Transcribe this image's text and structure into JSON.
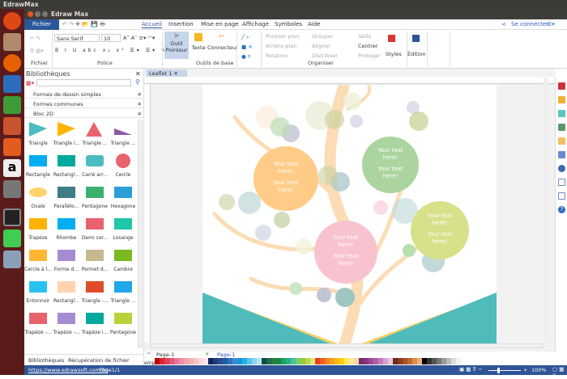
{
  "os": {
    "title": "EdrawMax"
  },
  "window": {
    "title": "Edraw Max"
  },
  "menu": {
    "file": "Fichier",
    "tabs": [
      "Accueil",
      "Insertion",
      "Mise en page",
      "Affichage",
      "Symboles",
      "Aide"
    ],
    "connect": "Se connecter"
  },
  "ribbon": {
    "font": "Sans Serif",
    "size": "10",
    "groups": [
      "Fichier",
      "Police",
      "Outils de base",
      "Organiser",
      "Styles",
      "Édition"
    ],
    "tools": {
      "pointer": "Outil Pointeur",
      "text": "Texte",
      "connector": "Connecteur"
    },
    "arrange": [
      "Premier plan",
      "Arrière-plan",
      "Rotation",
      "Grouper",
      "Aligner",
      "Distribuer",
      "Taille",
      "Centrer",
      "Protéger"
    ]
  },
  "library": {
    "title": "Bibliothèques",
    "sections": [
      "Formes de dessin simples",
      "Formes communes",
      "Bloc 2D"
    ],
    "shapes": [
      "Triangle",
      "Triangle i...",
      "Triangle ...",
      "Triangle ...",
      "Rectangle",
      "Rectangl...",
      "Carré arr...",
      "Cercle",
      "Ovale",
      "Parallélo...",
      "Pentagone",
      "Hexagone",
      "Trapèze",
      "Rhombe",
      "Demi cer...",
      "Losange",
      "Cercle à l...",
      "Forme d...",
      "Permet d...",
      "Cambre",
      "Entonnoir",
      "Rectangl...",
      "Triangle -...",
      "Triangle ...",
      "Trapèze -...",
      "Trapèze -...",
      "Trapèze i...",
      "Pentagone"
    ],
    "bottom_tabs": [
      "Bibliothèques",
      "Récupération de fichier"
    ]
  },
  "document": {
    "tab": "Leaflet 1",
    "bubble_text": "Your text here!",
    "page_select": "Page-1",
    "page_tab": "Page-1",
    "palette_label": "emp"
  },
  "status": {
    "url": "https://www.edrawsoft.com/fr/",
    "page": "Page1/1",
    "zoom": "100%"
  },
  "palette": [
    "#c00000",
    "#d9262f",
    "#e0405a",
    "#e2587a",
    "#e8739a",
    "#e891a8",
    "#f0a3a8",
    "#f3b2b0",
    "#f6c7c0",
    "#f9d8d8",
    "#fbe5ec",
    "#10255e",
    "#1f3a77",
    "#2e4a8e",
    "#1d5ea8",
    "#2d73c0",
    "#3c89d4",
    "#1499d8",
    "#21b0e4",
    "#55c3ec",
    "#8bd3f0",
    "#b3e0f2",
    "#0e4e3c",
    "#1a6b4f",
    "#2a7f3c",
    "#0f8a4a",
    "#1ca05c",
    "#26b38a",
    "#48c29c",
    "#6fcf6f",
    "#9bc93b",
    "#b8d64d",
    "#dde77a",
    "#e8401c",
    "#f0601c",
    "#f6851f",
    "#f8a21e",
    "#fbb913",
    "#ffd200",
    "#ffe55e",
    "#fce89c",
    "#f8d9a6",
    "#7a2a6a",
    "#8a3580",
    "#9e4896",
    "#b260a6",
    "#c27fb9",
    "#d4a4cd",
    "#e5c6e0",
    "#6e2a1a",
    "#8a3c20",
    "#a65028",
    "#c0692f",
    "#d98e4e",
    "#e8b27a",
    "#000000",
    "#333333",
    "#555555",
    "#777777",
    "#999999",
    "#bbbbbb",
    "#dddddd",
    "#f2f2f2"
  ]
}
